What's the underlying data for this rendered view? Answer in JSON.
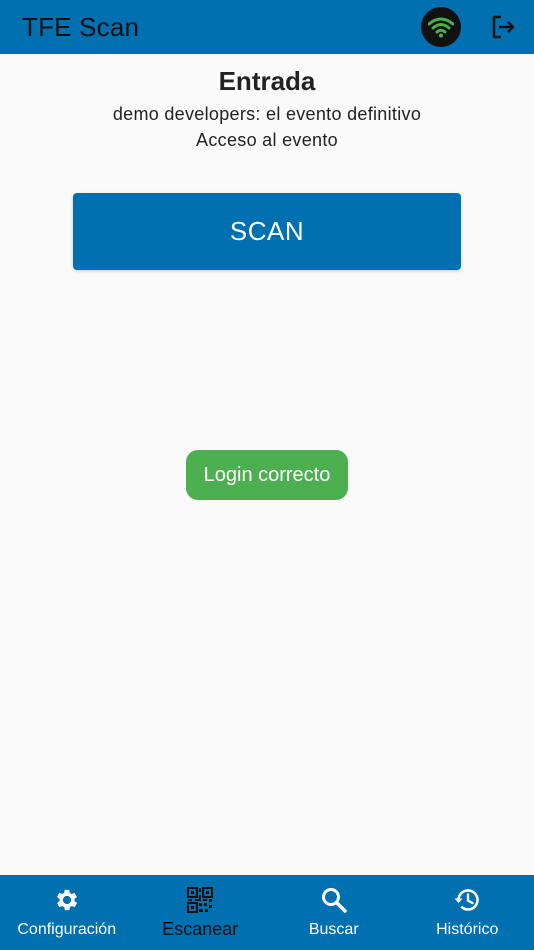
{
  "appbar": {
    "title": "TFE Scan",
    "wifi_icon": "wifi-icon",
    "logout_icon": "logout-icon",
    "wifi_color": "#4caf50"
  },
  "main": {
    "title": "Entrada",
    "event_name": "demo developers: el evento definitivo",
    "access_label": "Acceso al evento",
    "scan_button": "SCAN"
  },
  "toast": {
    "message": "Login correcto",
    "color": "#4caf50"
  },
  "bottom_nav": {
    "items": [
      {
        "label": "Configuración",
        "icon": "gear-icon",
        "active": false
      },
      {
        "label": "Escanear",
        "icon": "qr-code-icon",
        "active": true
      },
      {
        "label": "Buscar",
        "icon": "search-icon",
        "active": false
      },
      {
        "label": "Histórico",
        "icon": "history-icon",
        "active": false
      }
    ]
  },
  "colors": {
    "primary": "#0070b0",
    "background": "#fafafa"
  }
}
